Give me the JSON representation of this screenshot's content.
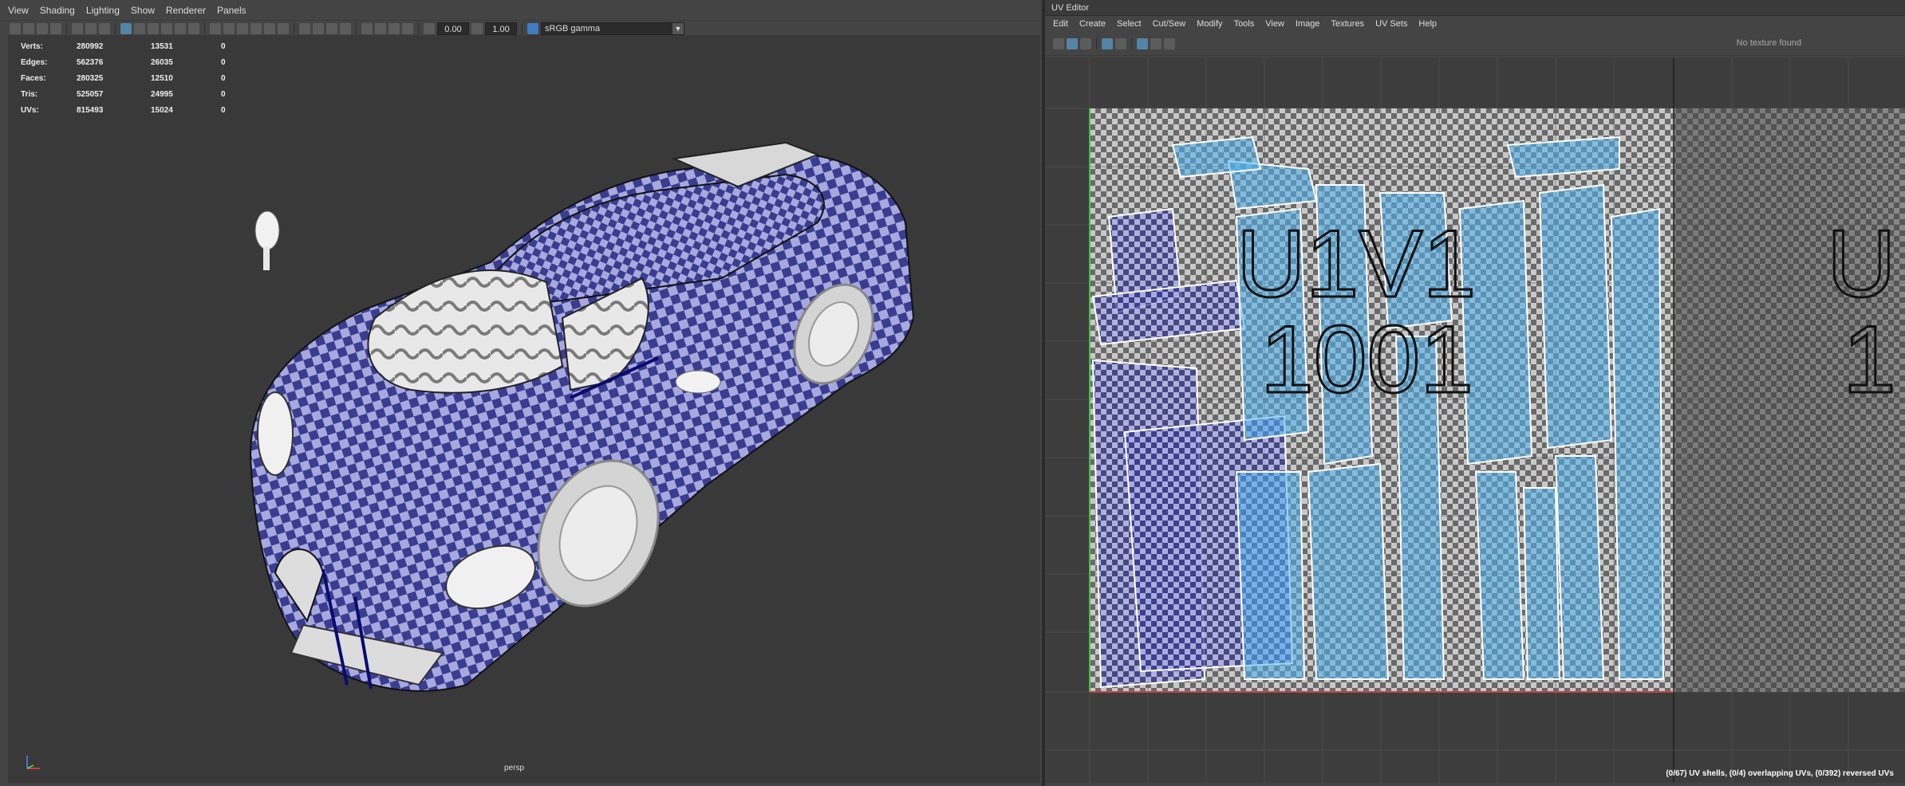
{
  "viewport_menu": [
    "View",
    "Shading",
    "Lighting",
    "Show",
    "Renderer",
    "Panels"
  ],
  "toolbar": {
    "exposure": "0.00",
    "gamma": "1.00",
    "color_space": "sRGB gamma"
  },
  "hud": {
    "rows": [
      {
        "label": "Verts:",
        "v1": "280992",
        "v2": "13531",
        "v3": "0"
      },
      {
        "label": "Edges:",
        "v1": "562376",
        "v2": "26035",
        "v3": "0"
      },
      {
        "label": "Faces:",
        "v1": "280325",
        "v2": "12510",
        "v3": "0"
      },
      {
        "label": "Tris:",
        "v1": "525057",
        "v2": "24995",
        "v3": "0"
      },
      {
        "label": "UVs:",
        "v1": "815493",
        "v2": "15024",
        "v3": "0"
      }
    ]
  },
  "camera_label": "persp",
  "uv_editor": {
    "title": "UV Editor",
    "menu": [
      "Edit",
      "Create",
      "Select",
      "Cut/Sew",
      "Modify",
      "Tools",
      "View",
      "Image",
      "Textures",
      "UV Sets",
      "Help"
    ],
    "no_texture": "No texture found",
    "tile_label_top": "U1V1",
    "tile_label_bottom": "1001",
    "next_tile_top": "U",
    "next_tile_bottom": "1",
    "status": "(0/67) UV shells, (0/4) overlapping UVs, (0/392) reversed UVs"
  },
  "colors": {
    "checker_dark": "#3a3d8f",
    "checker_light": "#a7a9de",
    "uv_shell": "#4fb3f0",
    "bg": "#444444"
  }
}
